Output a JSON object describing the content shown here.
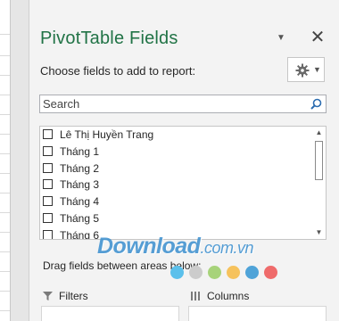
{
  "pane": {
    "title": "PivotTable Fields",
    "choose_label": "Choose fields to add to report:",
    "close_icon": "close-icon",
    "gear_icon": "gear-icon"
  },
  "search": {
    "placeholder": "Search",
    "value": ""
  },
  "fields": [
    {
      "label": "Lê Thị Huyền Trang",
      "checked": false
    },
    {
      "label": "Tháng 1",
      "checked": false
    },
    {
      "label": "Tháng 2",
      "checked": false
    },
    {
      "label": "Tháng 3",
      "checked": false
    },
    {
      "label": "Tháng 4",
      "checked": false
    },
    {
      "label": "Tháng 5",
      "checked": false
    },
    {
      "label": "Tháng 6",
      "checked": false
    }
  ],
  "watermark": {
    "brand": "Download",
    "suffix": ".com.vn"
  },
  "areas": {
    "drag_label": "Drag fields between areas below:",
    "filters_label": "Filters",
    "columns_label": "Columns"
  },
  "colors": {
    "accent": "#217346",
    "dots": [
      "#5bc0eb",
      "#cccccc",
      "#a7d37a",
      "#f6c25c",
      "#4fa3d8",
      "#ef6b6b"
    ]
  }
}
